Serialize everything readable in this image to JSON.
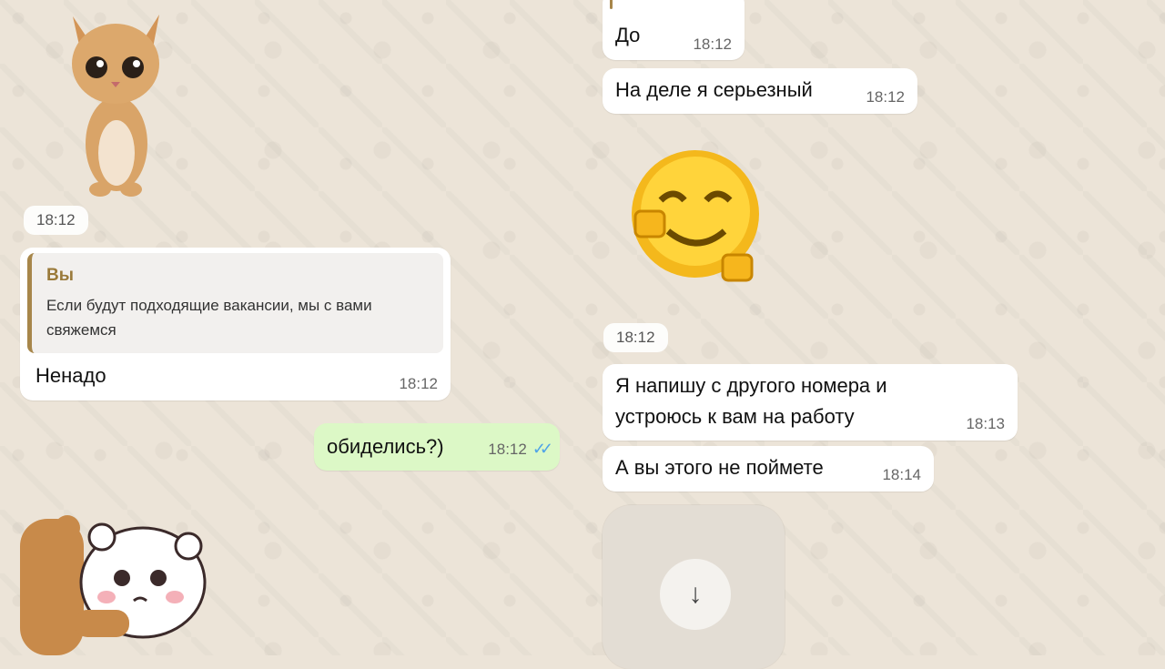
{
  "messages": {
    "do_text": "До",
    "do_time": "18:12",
    "serious_text": "На деле я серьезный",
    "serious_time": "18:12",
    "cat_sticker_time": "18:12",
    "smiley_sticker_time": "18:12",
    "reply_quote_author": "Вы",
    "reply_quote_text": "Если будут подходящие вакансии, мы с вами свяжемся",
    "reply_text": "Ненадо",
    "reply_time": "18:12",
    "offended_text": "обиделись?)",
    "offended_time": "18:12",
    "other_number_text": "Я напишу с другого номера и устроюсь к вам на работу",
    "other_number_time": "18:13",
    "wont_understand_text": "А вы этого не поймете",
    "wont_understand_time": "18:14"
  },
  "stickers": {
    "cat": "sad-kitten-sticker",
    "smiley": "pixel-smiley-sticker",
    "bears": "bears-hug-sticker"
  },
  "controls": {
    "scroll_down_icon": "arrow-down-icon"
  },
  "colors": {
    "outgoing_bubble": "#dcf8c6",
    "incoming_bubble": "#ffffff",
    "read_ticks": "#4fa3e8",
    "quote_accent": "#a7864a"
  }
}
